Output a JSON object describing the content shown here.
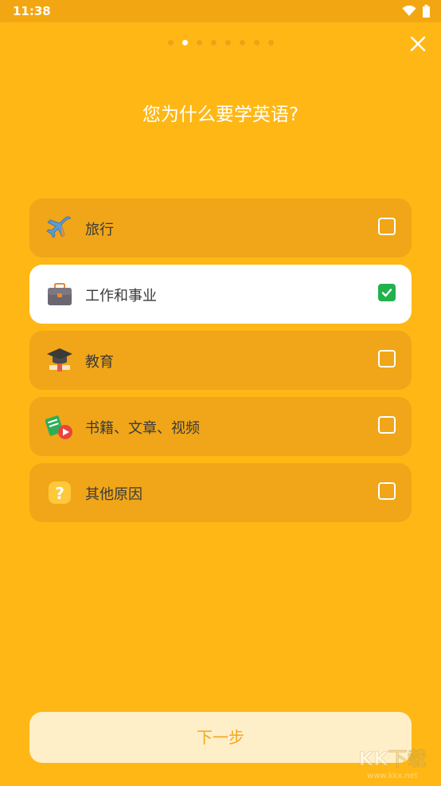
{
  "status_bar": {
    "time": "11:38",
    "icons": [
      "wifi-icon",
      "battery-icon"
    ]
  },
  "pager": {
    "total": 8,
    "active_index": 1
  },
  "header": {
    "title": "您为什么要学英语?"
  },
  "options": [
    {
      "label": "旅行",
      "icon": "airplane-icon",
      "checked": false
    },
    {
      "label": "工作和事业",
      "icon": "briefcase-icon",
      "checked": true
    },
    {
      "label": "教育",
      "icon": "graduation-cap-icon",
      "checked": false
    },
    {
      "label": "书籍、文章、视频",
      "icon": "books-video-icon",
      "checked": false
    },
    {
      "label": "其他原因",
      "icon": "question-icon",
      "checked": false
    }
  ],
  "footer": {
    "next_label": "下一步"
  },
  "watermark": {
    "text": "KK下载",
    "url": "www.kkx.net"
  },
  "colors": {
    "background": "#FEB715",
    "option_bg": "#F0A618",
    "selected_bg": "#FFFFFF",
    "check_green": "#22B14C",
    "button_bg": "#FFEFC9",
    "button_text": "#F5A61C"
  }
}
